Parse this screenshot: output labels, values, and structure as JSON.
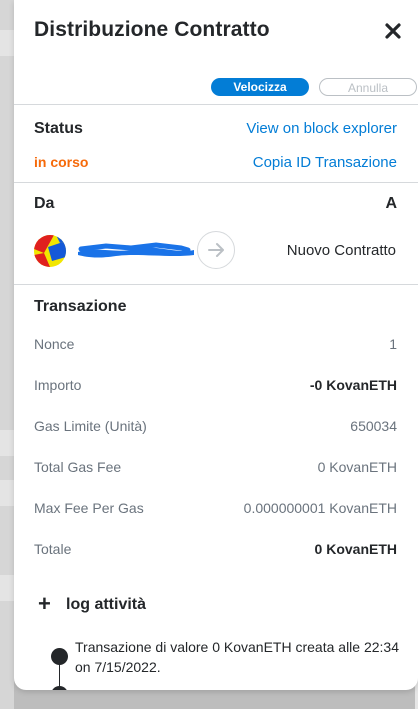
{
  "header": {
    "title": "Distribuzione Contratto",
    "close_icon": "close-icon"
  },
  "actions": {
    "speed_up": "Velocizza",
    "cancel": "Annulla"
  },
  "status": {
    "label": "Status",
    "value": "in corso",
    "value_color": "#f66a0a",
    "explorer_link": "View on block explorer",
    "copy_link": "Copia ID Transazione"
  },
  "parties": {
    "from_label": "Da",
    "to_label": "A",
    "from_address": "[redacted]",
    "to_name": "Nuovo Contratto",
    "arrow_icon": "arrow-right-icon"
  },
  "transaction": {
    "title": "Transazione",
    "rows": [
      {
        "key": "Nonce",
        "value": "1"
      },
      {
        "key": "Importo",
        "value": "-0 KovanETH"
      },
      {
        "key": "Gas Limite (Unità)",
        "value": "650034"
      },
      {
        "key": "Total Gas Fee",
        "value": "0 KovanETH"
      },
      {
        "key": "Max Fee Per Gas",
        "value": "0.000000001 KovanETH"
      },
      {
        "key": "Totale",
        "value": "0 KovanETH"
      }
    ]
  },
  "activity_log": {
    "title": "log attività",
    "entries": [
      {
        "text": "Transazione di valore 0 KovanETH creata alle 22:34 on 7/15/2022."
      }
    ]
  },
  "colors": {
    "accent": "#037dd6",
    "warning": "#f66a0a",
    "text": "#24272a",
    "muted": "#6a737d"
  }
}
